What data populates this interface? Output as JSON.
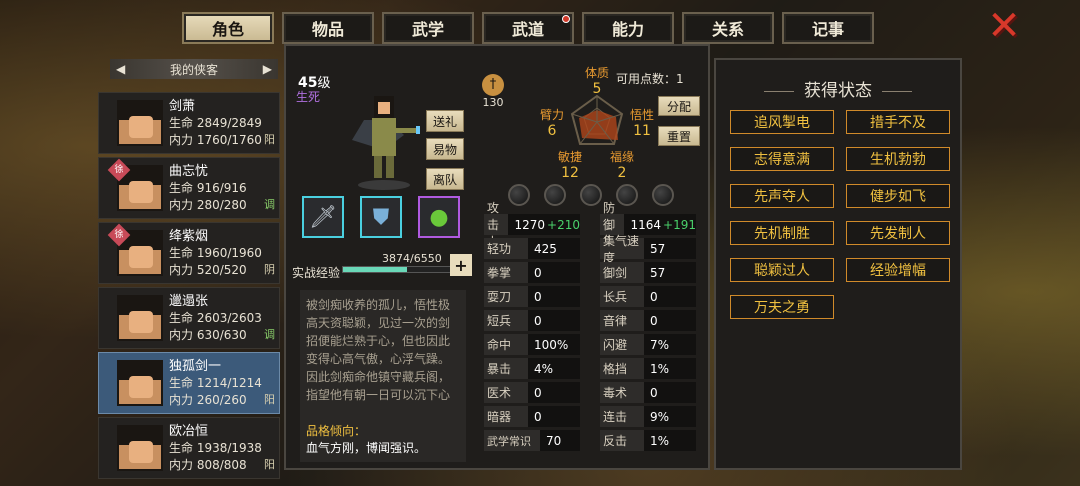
{
  "tabs": [
    {
      "label": "角色",
      "active": true
    },
    {
      "label": "物品"
    },
    {
      "label": "武学"
    },
    {
      "label": "武道",
      "dot": true
    },
    {
      "label": "能力"
    },
    {
      "label": "关系"
    },
    {
      "label": "记事"
    }
  ],
  "close_symbol": "✕",
  "list_header": "我的侠客",
  "heroes": [
    {
      "name": "剑萧",
      "hp": "生命 2849/2849",
      "mp": "内力 1760/1760",
      "yy": "阳"
    },
    {
      "name": "曲忘忧",
      "hp": "生命 916/916",
      "mp": "内力 280/280",
      "yy": "调",
      "tag": "徐"
    },
    {
      "name": "绛紫烟",
      "hp": "生命 1960/1960",
      "mp": "内力 520/520",
      "yy": "阴",
      "tag": "徐"
    },
    {
      "name": "邋遢张",
      "hp": "生命 2603/2603",
      "mp": "内力 630/630",
      "yy": "调"
    },
    {
      "name": "独孤剑一",
      "hp": "生命 1214/1214",
      "mp": "内力 260/260",
      "yy": "阳",
      "selected": true
    },
    {
      "name": "欧冶恒",
      "hp": "生命 1938/1938",
      "mp": "内力 808/808",
      "yy": "阳"
    }
  ],
  "char": {
    "level": "45",
    "level_unit": "级",
    "status": "生死",
    "btn_gift": "送礼",
    "btn_equip": "易物",
    "btn_leave": "离队",
    "exp_label": "实战经验",
    "exp_value": "3874/6550",
    "exp_progress": 0.59,
    "desc": "被剑痴收养的孤儿，悟性极高天资聪颖，见过一次的剑招便能烂熟于心，但也因此变得心高气傲，心浮气躁。因此剑痴命他镇守藏兵阁，指望他有朝一日可以沉下心",
    "trait_title": "品格倾向：",
    "trait_value": "血气方刚，博闻强识。"
  },
  "badge_value": "130",
  "points_label": "可用点数：",
  "points_value": "1",
  "btn_alloc": "分配",
  "btn_reset": "重置",
  "radar": {
    "tizhi": "体质",
    "tizhi_v": "5",
    "biji": "臂力",
    "biji_v": "6",
    "wuxing": "悟性",
    "wuxing_v": "11",
    "minjie": "敏捷",
    "minjie_v": "12",
    "fuyuan": "福缘",
    "fuyuan_v": "2"
  },
  "stats": [
    {
      "k": "攻击力",
      "v": "1270",
      "b": "+210"
    },
    {
      "k": "防御力",
      "v": "1164",
      "b": "+191"
    },
    {
      "k": "轻功",
      "v": "425"
    },
    {
      "k": "集气速度",
      "v": "57"
    },
    {
      "k": "拳掌",
      "v": "0"
    },
    {
      "k": "御剑",
      "v": "57"
    },
    {
      "k": "耍刀",
      "v": "0"
    },
    {
      "k": "长兵",
      "v": "0"
    },
    {
      "k": "短兵",
      "v": "0"
    },
    {
      "k": "音律",
      "v": "0"
    },
    {
      "k": "命中",
      "v": "100%"
    },
    {
      "k": "闪避",
      "v": "7%"
    },
    {
      "k": "暴击",
      "v": "4%"
    },
    {
      "k": "格挡",
      "v": "1%"
    },
    {
      "k": "医术",
      "v": "0"
    },
    {
      "k": "毒术",
      "v": "0"
    },
    {
      "k": "暗器",
      "v": "0"
    },
    {
      "k": "连击",
      "v": "9%"
    },
    {
      "k": "武学常识",
      "v": "70"
    },
    {
      "k": "反击",
      "v": "1%"
    }
  ],
  "status_title": "获得状态",
  "buffs": [
    "追风掣电",
    "措手不及",
    "志得意满",
    "生机勃勃",
    "先声夺人",
    "健步如飞",
    "先机制胜",
    "先发制人",
    "聪颖过人",
    "经验增幅",
    "万夫之勇"
  ],
  "colors": {
    "accent": "#f0c040",
    "buff_border": "#d08a2a",
    "selected": "#3c5a7a"
  }
}
